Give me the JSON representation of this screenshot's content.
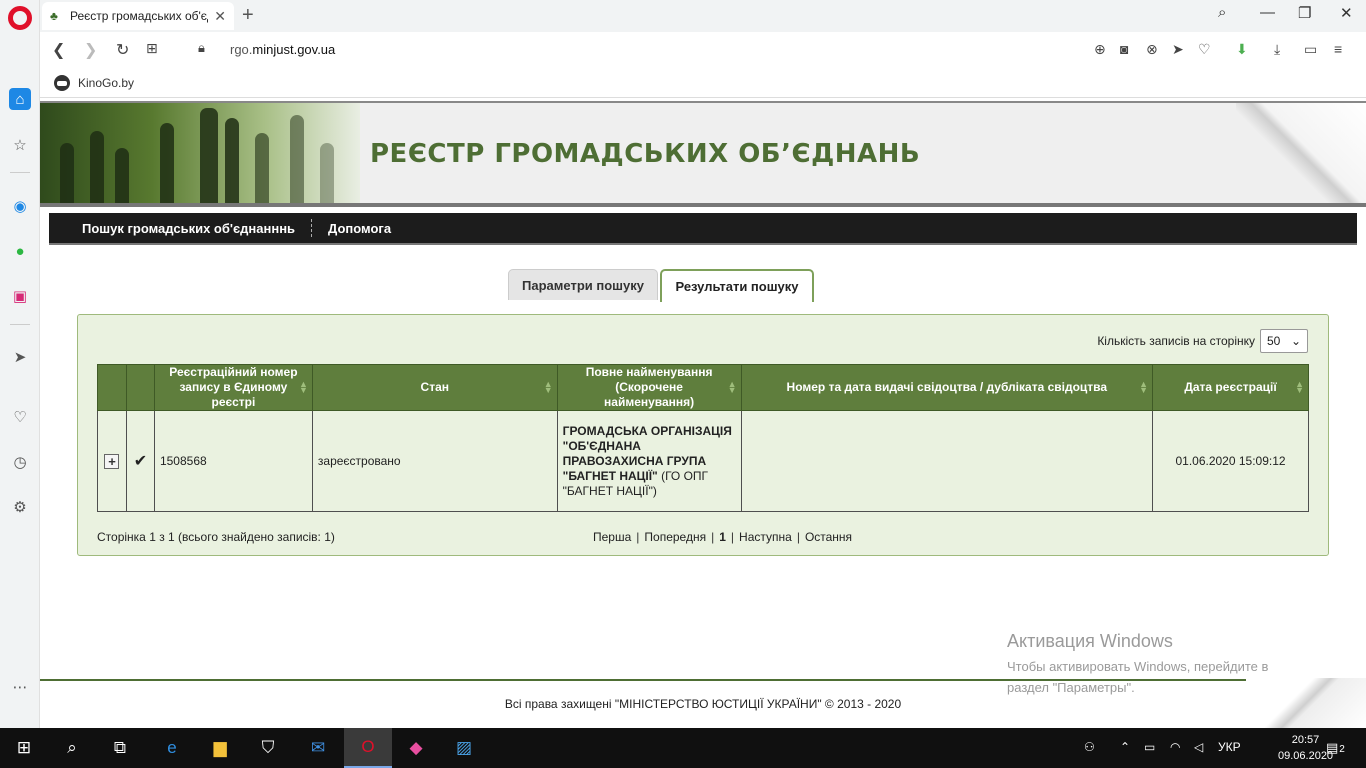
{
  "browser": {
    "tab_title": "Реєстр громадських об'єд",
    "url_prefix": "rgo.",
    "url_domain": "minjust.gov.ua",
    "bookmark_label": "KinoGo.by"
  },
  "site": {
    "banner_title": "РЕЄСТР ГРОМАДСЬКИХ ОБ’ЄДНАНЬ",
    "menu": [
      "Пошук громадських об'єднанннь",
      "Допомога"
    ],
    "tabs": {
      "params": "Параметри пошуку",
      "results": "Результати пошуку"
    }
  },
  "results": {
    "perpage_label": "Кількість записів на сторінку",
    "perpage_value": "50",
    "columns": [
      "",
      "",
      "Реєстраційний номер запису в Єдиному реєстрі",
      "Стан",
      "Повне найменування (Скорочене найменування)",
      "Номер та дата видачі свідоцтва / дубліката свідоцтва",
      "Дата реєстрації"
    ],
    "row": {
      "reg_number": "1508568",
      "status": "зареєстровано",
      "full_name": "ГРОМАДСЬКА ОРГАНІЗАЦІЯ \"ОБ'ЄДНАНА ПРАВОЗАХИСНА ГРУПА \"БАГНЕТ НАЦІЇ\"",
      "short_name": "(ГО ОПГ \"БАГНЕТ НАЦІЇ\")",
      "certificate": "",
      "reg_date": "01.06.2020 15:09:12"
    },
    "pager_info": "Сторінка 1 з 1 (всього знайдено записів: 1)",
    "pager": {
      "first": "Перша",
      "prev": "Попередня",
      "current": "1",
      "next": "Наступна",
      "last": "Остання"
    }
  },
  "watermark": {
    "title": "Активация Windows",
    "line1": "Чтобы активировать Windows, перейдите в",
    "line2": "раздел \"Параметры\"."
  },
  "footer": "Всі права захищені \"МІНІСТЕРСТВО ЮСТИЦІЇ УКРАЇНИ\" © 2013 - 2020",
  "taskbar": {
    "lang": "УКР",
    "time": "20:57",
    "date": "09.06.2020",
    "notifications": "2"
  }
}
